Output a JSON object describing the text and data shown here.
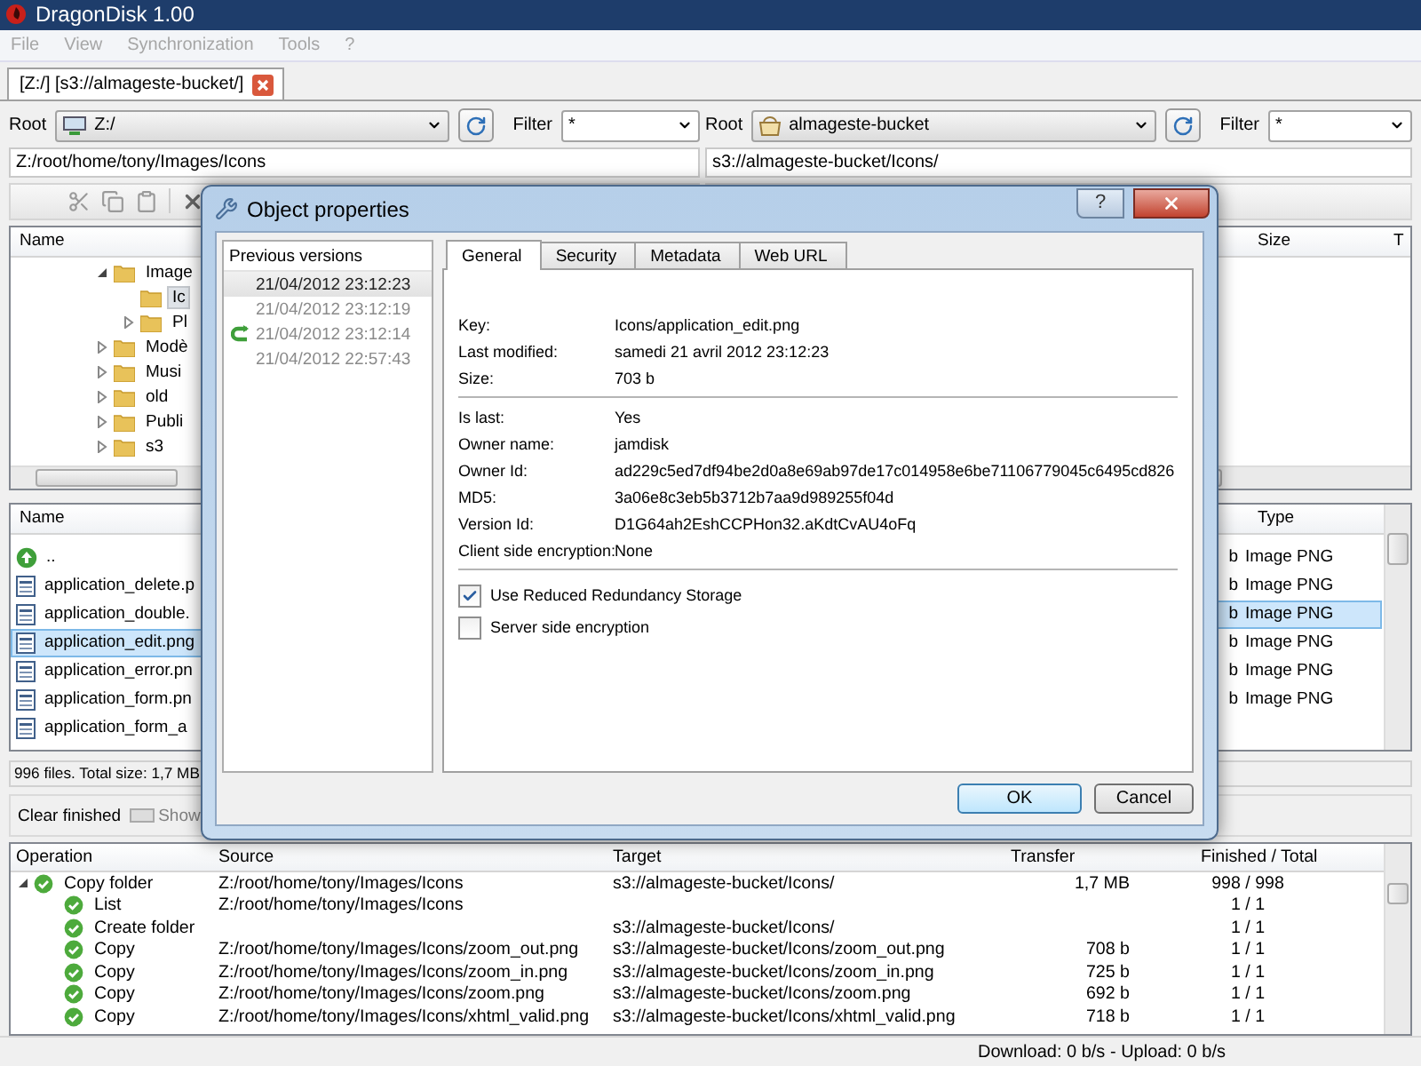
{
  "window": {
    "title": "DragonDisk 1.00"
  },
  "menu": [
    {
      "label": "File",
      "disabled": true
    },
    {
      "label": "View",
      "disabled": true
    },
    {
      "label": "Synchronization",
      "disabled": true
    },
    {
      "label": "Tools",
      "disabled": true
    },
    {
      "label": "?",
      "disabled": true
    }
  ],
  "tabs": [
    {
      "label": "[Z:/] [s3://almageste-bucket/]",
      "selected": true
    }
  ],
  "left_pane": {
    "root_label": "Root",
    "root_value": "Z:/",
    "filter_label": "Filter",
    "filter_value": "*",
    "path": "Z:/root/home/tony/Images/Icons",
    "tree": {
      "columns": [
        "Name"
      ],
      "items": [
        {
          "label": "Image",
          "expanded": true,
          "children": [
            {
              "label": "Ic",
              "selected": true
            },
            {
              "label": "Pl",
              "expanded": false
            }
          ]
        },
        {
          "label": "Modè",
          "expanded": false
        },
        {
          "label": "Musi",
          "expanded": false
        },
        {
          "label": "old",
          "expanded": false
        },
        {
          "label": "Publi",
          "expanded": false
        },
        {
          "label": "s3",
          "expanded": false
        }
      ]
    },
    "files": {
      "columns": [
        "Name"
      ],
      "rows": [
        {
          "name": "..",
          "kind": "parent",
          "selected": false
        },
        {
          "name": "application_delete.p",
          "kind": "file",
          "selected": false
        },
        {
          "name": "application_double.",
          "kind": "file",
          "selected": false
        },
        {
          "name": "application_edit.png",
          "kind": "file",
          "selected": true
        },
        {
          "name": "application_error.pn",
          "kind": "file",
          "selected": false
        },
        {
          "name": "application_form.pn",
          "kind": "file",
          "selected": false
        },
        {
          "name": "application_form_a",
          "kind": "file",
          "selected": false
        }
      ]
    },
    "status": "996 files. Total size: 1,7 MB"
  },
  "right_pane": {
    "root_label": "Root",
    "root_value": "almageste-bucket",
    "filter_label": "Filter",
    "filter_value": "*",
    "path": "s3://almageste-bucket/Icons/",
    "tree": {
      "columns": [
        "Size",
        "T"
      ]
    },
    "files": {
      "columns": [
        "Type"
      ],
      "rows": [
        {
          "size": "b",
          "type": "Image PNG",
          "selected": false
        },
        {
          "size": "b",
          "type": "Image PNG",
          "selected": false
        },
        {
          "size": "b",
          "type": "Image PNG",
          "selected": true
        },
        {
          "size": "b",
          "type": "Image PNG",
          "selected": false
        },
        {
          "size": "b",
          "type": "Image PNG",
          "selected": false
        },
        {
          "size": "b",
          "type": "Image PNG",
          "selected": false
        }
      ]
    }
  },
  "transfers": {
    "clear_button": "Clear finished",
    "show_button": {
      "label": "Show",
      "disabled": true
    },
    "columns": [
      "Operation",
      "Source",
      "Target",
      "Transfer",
      "Finished / Total"
    ],
    "rows": [
      {
        "operation": "Copy folder",
        "source": "Z:/root/home/tony/Images/Icons",
        "target": "s3://almageste-bucket/Icons/",
        "transfer": "1,7 MB",
        "finished": "998 / 998",
        "expanded": true,
        "children": [
          {
            "operation": "List",
            "source": "Z:/root/home/tony/Images/Icons",
            "finished": "1 / 1"
          },
          {
            "operation": "Create folder",
            "target": "s3://almageste-bucket/Icons/",
            "finished": "1 / 1"
          },
          {
            "operation": "Copy",
            "source": "Z:/root/home/tony/Images/Icons/zoom_out.png",
            "target": "s3://almageste-bucket/Icons/zoom_out.png",
            "transfer": "708 b",
            "finished": "1 / 1"
          },
          {
            "operation": "Copy",
            "source": "Z:/root/home/tony/Images/Icons/zoom_in.png",
            "target": "s3://almageste-bucket/Icons/zoom_in.png",
            "transfer": "725 b",
            "finished": "1 / 1"
          },
          {
            "operation": "Copy",
            "source": "Z:/root/home/tony/Images/Icons/zoom.png",
            "target": "s3://almageste-bucket/Icons/zoom.png",
            "transfer": "692 b",
            "finished": "1 / 1"
          },
          {
            "operation": "Copy",
            "source": "Z:/root/home/tony/Images/Icons/xhtml_valid.png",
            "target": "s3://almageste-bucket/Icons/xhtml_valid.png",
            "transfer": "718 b",
            "finished": "1 / 1"
          }
        ]
      }
    ]
  },
  "status_bar": "Download: 0 b/s - Upload: 0 b/s",
  "dialog": {
    "title": "Object properties",
    "help_button": "?",
    "versions": {
      "heading": "Previous versions",
      "items": [
        {
          "label": "21/04/2012 23:12:23",
          "selected": true,
          "kind": "version"
        },
        {
          "label": "21/04/2012 23:12:19",
          "selected": false,
          "kind": "version"
        },
        {
          "label": "21/04/2012 23:12:14",
          "selected": false,
          "kind": "restored"
        },
        {
          "label": "21/04/2012 22:57:43",
          "selected": false,
          "kind": "version"
        }
      ]
    },
    "tabs": [
      {
        "label": "General",
        "selected": true
      },
      {
        "label": "Security",
        "selected": false
      },
      {
        "label": "Metadata",
        "selected": false
      },
      {
        "label": "Web URL",
        "selected": false
      }
    ],
    "sections": [
      {
        "fields": [
          {
            "label": "Key:",
            "value": "Icons/application_edit.png"
          },
          {
            "label": "Last modified:",
            "value": "samedi 21 avril 2012 23:12:23"
          },
          {
            "label": "Size:",
            "value": "703 b"
          }
        ]
      },
      {
        "fields": [
          {
            "label": "Is last:",
            "value": "Yes"
          },
          {
            "label": "Owner name:",
            "value": "jamdisk"
          },
          {
            "label": "Owner Id:",
            "value": "ad229c5ed7df94be2d0a8e69ab97de17c014958e6be71106779045c6495cd826"
          },
          {
            "label": "MD5:",
            "value": "3a06e8c3eb5b3712b7aa9d989255f04d"
          },
          {
            "label": "Version Id:",
            "value": "D1G64ah2EshCCPHon32.aKdtCvAU4oFq"
          },
          {
            "label": "Client side encryption:",
            "value": "None"
          }
        ]
      }
    ],
    "checkboxes": [
      {
        "label": "Use Reduced Redundancy Storage",
        "checked": true
      },
      {
        "label": "Server side encryption",
        "checked": false
      }
    ],
    "buttons": [
      {
        "label": "OK",
        "default": true
      },
      {
        "label": "Cancel",
        "default": false
      }
    ]
  }
}
